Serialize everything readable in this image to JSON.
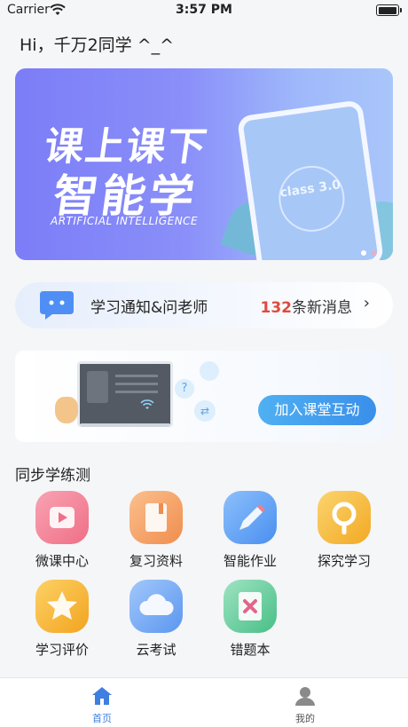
{
  "status_bar": {
    "carrier": "Carrier",
    "time": "3:57 PM"
  },
  "greeting": "Hi，千万2同学  ^_^",
  "banner": {
    "headline1": "课上课下",
    "headline2": "智能学",
    "subtitle": "ARTIFICIAL INTELLIGENCE",
    "phone_text": "class 3.0"
  },
  "notice": {
    "label": "学习通知&问老师",
    "count": "132",
    "count_suffix": "条新消息",
    "arrow": "›"
  },
  "join_class": {
    "button_label": "加入课堂互动"
  },
  "section_title": "同步学练测",
  "features": [
    {
      "label": "微课中心",
      "icon": "video-icon",
      "color": "#f4869a"
    },
    {
      "label": "复习资料",
      "icon": "book-icon",
      "color": "#f6a66b"
    },
    {
      "label": "智能作业",
      "icon": "pencil-icon",
      "color": "#5fa0f3"
    },
    {
      "label": "探究学习",
      "icon": "magnifier-icon",
      "color": "#f5bd3b"
    },
    {
      "label": "学习评价",
      "icon": "star-icon",
      "color": "#f5b437"
    },
    {
      "label": "云考试",
      "icon": "cloud-icon",
      "color": "#6da8f3"
    },
    {
      "label": "错题本",
      "icon": "notebook-icon",
      "color": "#72cfa0"
    }
  ],
  "tabs": [
    {
      "label": "首页",
      "icon": "home-icon",
      "active": true
    },
    {
      "label": "我的",
      "icon": "profile-icon",
      "active": false
    }
  ],
  "colors": {
    "accent": "#3a8fea",
    "count_red": "#e04a3c",
    "tab_active": "#3f7fe0",
    "tab_inactive": "#555555"
  }
}
